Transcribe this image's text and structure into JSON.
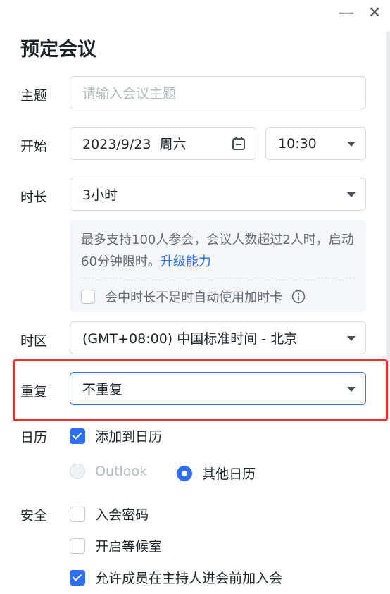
{
  "window": {
    "minimize_glyph": "—",
    "close_glyph": "✕"
  },
  "title": "预定会议",
  "subject": {
    "label": "主题",
    "placeholder": "请输入会议主题"
  },
  "start": {
    "label": "开始",
    "date": "2023/9/23  周六",
    "time": "10:30",
    "calendar_icon": "calendar-icon"
  },
  "duration": {
    "label": "时长",
    "value": "3小时"
  },
  "notice": {
    "text": "最多支持100人参会，会议人数超过2人时，启动60分钟限时。",
    "link": "升级能力",
    "auto_extend_label": "会中时长不足时自动使用加时卡",
    "auto_extend_checked": false
  },
  "timezone": {
    "label": "时区",
    "value": "(GMT+08:00) 中国标准时间 - 北京"
  },
  "repeat": {
    "label": "重复",
    "value": "不重复",
    "highlight_color": "#e8302f"
  },
  "calendar": {
    "label": "日历",
    "add_label": "添加到日历",
    "add_checked": true,
    "options": [
      {
        "label": "Outlook",
        "selected": false,
        "disabled": true
      },
      {
        "label": "其他日历",
        "selected": true,
        "disabled": false
      }
    ]
  },
  "security": {
    "label": "安全",
    "options": [
      {
        "label": "入会密码",
        "checked": false
      },
      {
        "label": "开启等候室",
        "checked": false
      },
      {
        "label": "允许成员在主持人进会前加入会",
        "checked": true
      }
    ]
  },
  "colors": {
    "accent": "#2f6ff0",
    "text": "#1f2329",
    "muted": "#646a73",
    "placeholder": "#b5b9bf"
  }
}
